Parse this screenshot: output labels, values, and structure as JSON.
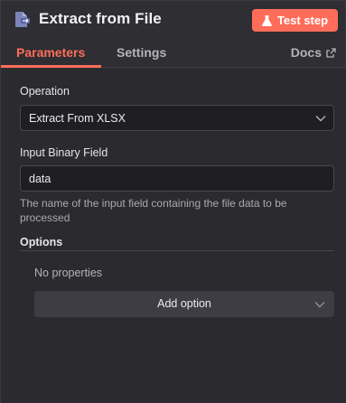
{
  "header": {
    "title": "Extract from File",
    "test_button_label": "Test step",
    "accent_color": "#ff6d5a"
  },
  "tabs": {
    "items": [
      {
        "label": "Parameters",
        "active": true
      },
      {
        "label": "Settings",
        "active": false
      }
    ],
    "docs_label": "Docs"
  },
  "form": {
    "operation": {
      "label": "Operation",
      "value": "Extract From XLSX"
    },
    "input_binary_field": {
      "label": "Input Binary Field",
      "value": "data",
      "hint": "The name of the input field containing the file data to be processed"
    },
    "options": {
      "label": "Options",
      "empty_text": "No properties",
      "add_button_label": "Add option"
    }
  },
  "icons": {
    "node": "file-extract-icon",
    "test": "flask-icon",
    "docs": "external-link-icon",
    "dropdown": "chevron-down-icon"
  }
}
